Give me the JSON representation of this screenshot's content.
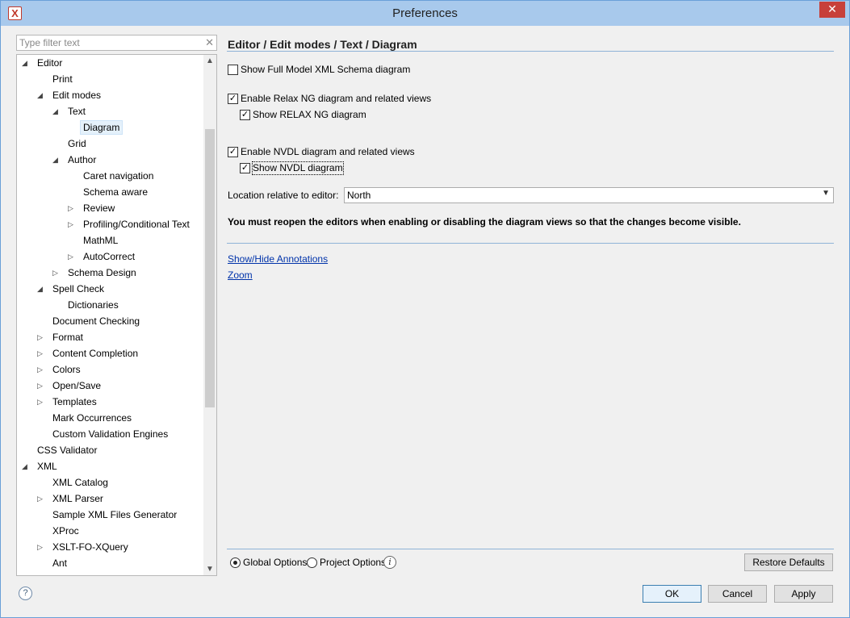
{
  "window": {
    "title": "Preferences",
    "close_glyph": "✕",
    "app_icon": "oxygen-x-icon"
  },
  "filter": {
    "placeholder": "Type filter text",
    "clear_glyph": "✕"
  },
  "tree": {
    "items": [
      {
        "label": "Editor",
        "expanded": true
      },
      {
        "label": "Print"
      },
      {
        "label": "Edit modes",
        "expanded": true
      },
      {
        "label": "Text",
        "expanded": true
      },
      {
        "label": "Diagram",
        "selected": true
      },
      {
        "label": "Grid"
      },
      {
        "label": "Author",
        "expanded": true
      },
      {
        "label": "Caret navigation"
      },
      {
        "label": "Schema aware"
      },
      {
        "label": "Review",
        "collapsed": true
      },
      {
        "label": "Profiling/Conditional Text",
        "collapsed": true
      },
      {
        "label": "MathML"
      },
      {
        "label": "AutoCorrect",
        "collapsed": true
      },
      {
        "label": "Schema Design",
        "collapsed": true
      },
      {
        "label": "Spell Check",
        "expanded": true
      },
      {
        "label": "Dictionaries"
      },
      {
        "label": "Document Checking"
      },
      {
        "label": "Format",
        "collapsed": true
      },
      {
        "label": "Content Completion",
        "collapsed": true
      },
      {
        "label": "Colors",
        "collapsed": true
      },
      {
        "label": "Open/Save",
        "collapsed": true
      },
      {
        "label": "Templates",
        "collapsed": true
      },
      {
        "label": "Mark Occurrences"
      },
      {
        "label": "Custom Validation Engines"
      },
      {
        "label": "CSS Validator"
      },
      {
        "label": "XML",
        "expanded": true
      },
      {
        "label": "XML Catalog"
      },
      {
        "label": "XML Parser",
        "collapsed": true
      },
      {
        "label": "Sample XML Files Generator"
      },
      {
        "label": "XProc"
      },
      {
        "label": "XSLT-FO-XQuery",
        "collapsed": true
      },
      {
        "label": "Ant"
      }
    ],
    "expanded_glyph": "◢",
    "collapsed_glyph": "▷"
  },
  "panel": {
    "title": "Editor / Edit modes / Text / Diagram",
    "options": {
      "full_model": {
        "label": "Show Full Model XML Schema diagram",
        "checked": false
      },
      "relax_enable": {
        "label": "Enable Relax NG diagram and related views",
        "checked": true
      },
      "relax_show": {
        "label": "Show RELAX NG diagram",
        "checked": true
      },
      "nvdl_enable": {
        "label": "Enable NVDL diagram and related views",
        "checked": true
      },
      "nvdl_show": {
        "label": "Show NVDL diagram",
        "checked": true
      }
    },
    "location_label": "Location relative to editor:",
    "location_value": "North",
    "notice": "You must reopen the editors when enabling or disabling the diagram views so that the changes become visible.",
    "links": {
      "annotations": "Show/Hide Annotations",
      "zoom": "Zoom"
    }
  },
  "scope": {
    "global": "Global Options",
    "project": "Project Options",
    "selected": "global"
  },
  "buttons": {
    "restore": "Restore Defaults",
    "ok": "OK",
    "cancel": "Cancel",
    "apply": "Apply"
  },
  "icons": {
    "help": "?",
    "info": "i",
    "check": "✓",
    "dropdown": "⌄"
  }
}
